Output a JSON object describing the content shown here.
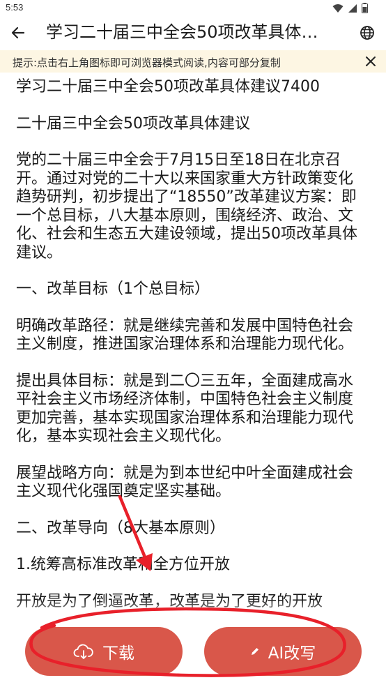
{
  "status_bar": {
    "time": "5:53"
  },
  "app_bar": {
    "title": "学习二十届三中全会50项改革具体…"
  },
  "notice": {
    "text": "提示:点击右上角图标即可浏览器模式阅读,内容可部分复制"
  },
  "article": {
    "paragraphs": [
      "学习二十届三中全会50项改革具体建议7400",
      "二十届三中全会50项改革具体建议",
      "党的二十届三中全会于7月15日至18日在北京召开。通过对党的二十大以来国家重大方针政策变化趋势研判，初步提出了“18550”改革建议方案：即一个总目标，八大基本原则，围绕经济、政治、文化、社会和生态五大建设领域，提出50项改革具体建议。",
      "一、改革目标（1个总目标）",
      "明确改革路径：就是继续完善和发展中国特色社会主义制度，推进国家治理体系和治理能力现代化。",
      "提出具体目标：就是到二〇三五年，全面建成高水平社会主义市场经济体制，中国特色社会主义制度更加完善，基本实现国家治理体系和治理能力现代化，基本实现社会主义现代化。",
      "展望战略方向：就是为到本世纪中叶全面建成社会主义现代化强国奠定坚实基础。",
      "二、改革导向（8大基本原则）",
      "1.统筹高标准改革和全方位开放",
      "开放是为了倒逼改革，改革是为了更好的开放"
    ]
  },
  "buttons": {
    "download": "下载",
    "ai_rewrite": "AI改写"
  },
  "colors": {
    "button_bg": "#d9574a",
    "notice_bg": "#fdf6e3",
    "annotation_red": "#e8202a"
  }
}
